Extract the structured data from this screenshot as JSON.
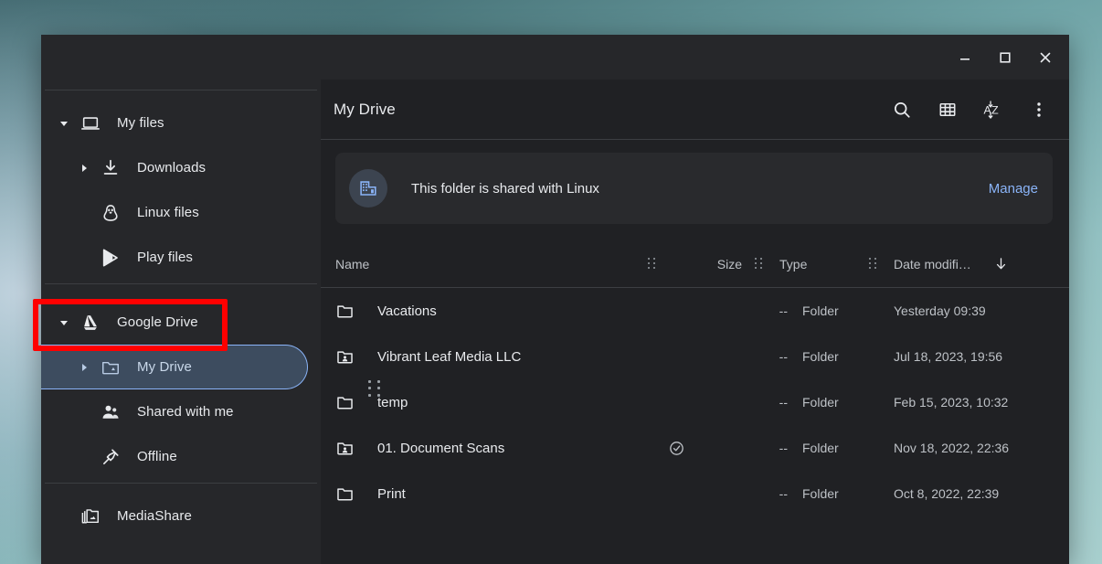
{
  "window": {
    "controls": [
      {
        "name": "minimize",
        "label": "Minimize"
      },
      {
        "name": "maximize",
        "label": "Maximize"
      },
      {
        "name": "close",
        "label": "Close"
      }
    ]
  },
  "sidebar": {
    "groups": [
      {
        "items": [
          {
            "label": "My files",
            "icon": "laptop-icon",
            "twisty": "down",
            "indent": false,
            "selected": false
          },
          {
            "label": "Downloads",
            "icon": "download-icon",
            "twisty": "right",
            "indent": true,
            "selected": false
          },
          {
            "label": "Linux files",
            "icon": "linux-tux-icon",
            "twisty": "none",
            "indent": true,
            "selected": false
          },
          {
            "label": "Play files",
            "icon": "play-store-icon",
            "twisty": "none",
            "indent": true,
            "selected": false
          }
        ]
      },
      {
        "items": [
          {
            "label": "Google Drive",
            "icon": "google-drive-icon",
            "twisty": "down",
            "indent": false,
            "selected": false
          },
          {
            "label": "My Drive",
            "icon": "drive-folder-icon",
            "twisty": "right",
            "indent": true,
            "selected": true
          },
          {
            "label": "Shared with me",
            "icon": "people-icon",
            "twisty": "none",
            "indent": true,
            "selected": false
          },
          {
            "label": "Offline",
            "icon": "pin-icon",
            "twisty": "none",
            "indent": true,
            "selected": false
          }
        ]
      },
      {
        "items": [
          {
            "label": "MediaShare",
            "icon": "smb-share-icon",
            "twisty": "none",
            "indent": false,
            "selected": false
          }
        ]
      }
    ],
    "resize_grip": "sidebar-resize-grip"
  },
  "main": {
    "title": "My Drive",
    "toolbar_buttons": [
      {
        "name": "search-icon",
        "label": "Search"
      },
      {
        "name": "grid-view-icon",
        "label": "Switch to grid view"
      },
      {
        "name": "sort-az-icon",
        "label": "Sort A-Z"
      },
      {
        "name": "more-vert-icon",
        "label": "More options"
      }
    ],
    "banner": {
      "icon": "linux-share-building-icon",
      "text": "This folder is shared with Linux",
      "action_label": "Manage",
      "action_color": "#8ab4f8"
    },
    "columns": [
      {
        "key": "name",
        "label": "Name"
      },
      {
        "key": "size",
        "label": "Size"
      },
      {
        "key": "type",
        "label": "Type"
      },
      {
        "key": "date",
        "label": "Date modifi…"
      }
    ],
    "sort": {
      "column": "date",
      "direction": "descending",
      "glyph": "down-arrow-icon"
    },
    "rows": [
      {
        "name": "Vacations",
        "icon": "folder-icon",
        "offline": false,
        "size": "--",
        "type": "Folder",
        "date": "Yesterday 09:39"
      },
      {
        "name": "Vibrant Leaf Media LLC",
        "icon": "shared-folder-icon",
        "offline": false,
        "size": "--",
        "type": "Folder",
        "date": "Jul 18, 2023, 19:56"
      },
      {
        "name": "temp",
        "icon": "folder-icon",
        "offline": false,
        "size": "--",
        "type": "Folder",
        "date": "Feb 15, 2023, 10:32"
      },
      {
        "name": "01. Document Scans",
        "icon": "shared-folder-icon",
        "offline": true,
        "size": "--",
        "type": "Folder",
        "date": "Nov 18, 2022, 22:36"
      },
      {
        "name": "Print",
        "icon": "folder-icon",
        "offline": false,
        "size": "--",
        "type": "Folder",
        "date": "Oct 8, 2022, 22:39"
      }
    ]
  },
  "annotation": {
    "target": "Google Drive",
    "color": "#ff0000"
  },
  "colors": {
    "window_bg": "#202124",
    "sidebar_bg": "#26272a",
    "banner_bg": "#292a2d",
    "accent_blue": "#8ab4f8",
    "selected_bg": "#3d4c5f",
    "text_primary": "#e8eaed",
    "text_secondary": "#bdc1c6"
  }
}
